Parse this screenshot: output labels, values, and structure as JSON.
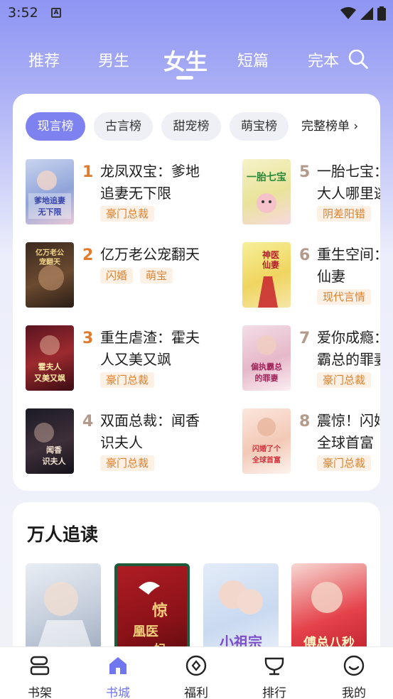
{
  "status_bar": {
    "time": "3:52",
    "sim_label": "A"
  },
  "category_tabs": [
    {
      "label": "推荐"
    },
    {
      "label": "男生"
    },
    {
      "label": "女生",
      "active": true
    },
    {
      "label": "短篇"
    },
    {
      "label": "完本"
    }
  ],
  "ranking": {
    "chips": [
      {
        "label": "现言榜",
        "active": true
      },
      {
        "label": "古言榜"
      },
      {
        "label": "甜宠榜"
      },
      {
        "label": "萌宝榜"
      }
    ],
    "full_list_label": "完整榜单",
    "books": [
      {
        "rank": "1",
        "title": "龙凤双宝：爹地追妻无下限",
        "tags": [
          "豪门总裁"
        ],
        "cover_text": "爹地追妻无下限"
      },
      {
        "rank": "2",
        "title": "亿万老公宠翻天",
        "tags": [
          "闪婚",
          "萌宝"
        ],
        "cover_text": "亿万老公宠翻天"
      },
      {
        "rank": "3",
        "title": "重生虐渣：霍夫人又美又飒",
        "tags": [
          "豪门总裁"
        ],
        "cover_text": "霍夫人又美又飒"
      },
      {
        "rank": "4",
        "title": "双面总裁：闻香识夫人",
        "tags": [
          "豪门总裁"
        ],
        "cover_text": "闻香识夫人"
      },
      {
        "rank": "5",
        "title": "一胎七宝：老婆大人哪里逃",
        "tags": [
          "阴差阳错"
        ],
        "cover_text": "一胎七宝"
      },
      {
        "rank": "6",
        "title": "重生空间：神医仙妻",
        "tags": [
          "现代言情"
        ],
        "cover_text": "神医仙妻"
      },
      {
        "rank": "7",
        "title": "爱你成瘾：偏执霸总的罪妻",
        "tags": [
          "豪门总裁"
        ],
        "cover_text": "偏执霸总的罪妻"
      },
      {
        "rank": "8",
        "title": "震惊！闪婚了个全球首富",
        "tags": [
          "豪门总裁"
        ],
        "cover_text": "闪婚了个全球首富"
      }
    ]
  },
  "popular": {
    "heading": "万人追读",
    "covers": [
      {
        "name": "cover-1",
        "text": ""
      },
      {
        "name": "cover-2",
        "text": "惊凰医妃"
      },
      {
        "name": "cover-3",
        "text": "小祖宗"
      },
      {
        "name": "cover-4",
        "text": "傅总八秒"
      }
    ]
  },
  "bottom_nav": [
    {
      "label": "书架",
      "icon": "bookshelf-icon"
    },
    {
      "label": "书城",
      "icon": "bookstore-icon",
      "active": true
    },
    {
      "label": "福利",
      "icon": "welfare-icon"
    },
    {
      "label": "排行",
      "icon": "trophy-icon"
    },
    {
      "label": "我的",
      "icon": "profile-icon"
    }
  ],
  "colors": {
    "accent": "#7d82f0",
    "rank_top": "#e07a2c",
    "rank_other": "#b39a8a",
    "tag_bg": "#fdf1e6",
    "tag_text": "#d9812f"
  }
}
